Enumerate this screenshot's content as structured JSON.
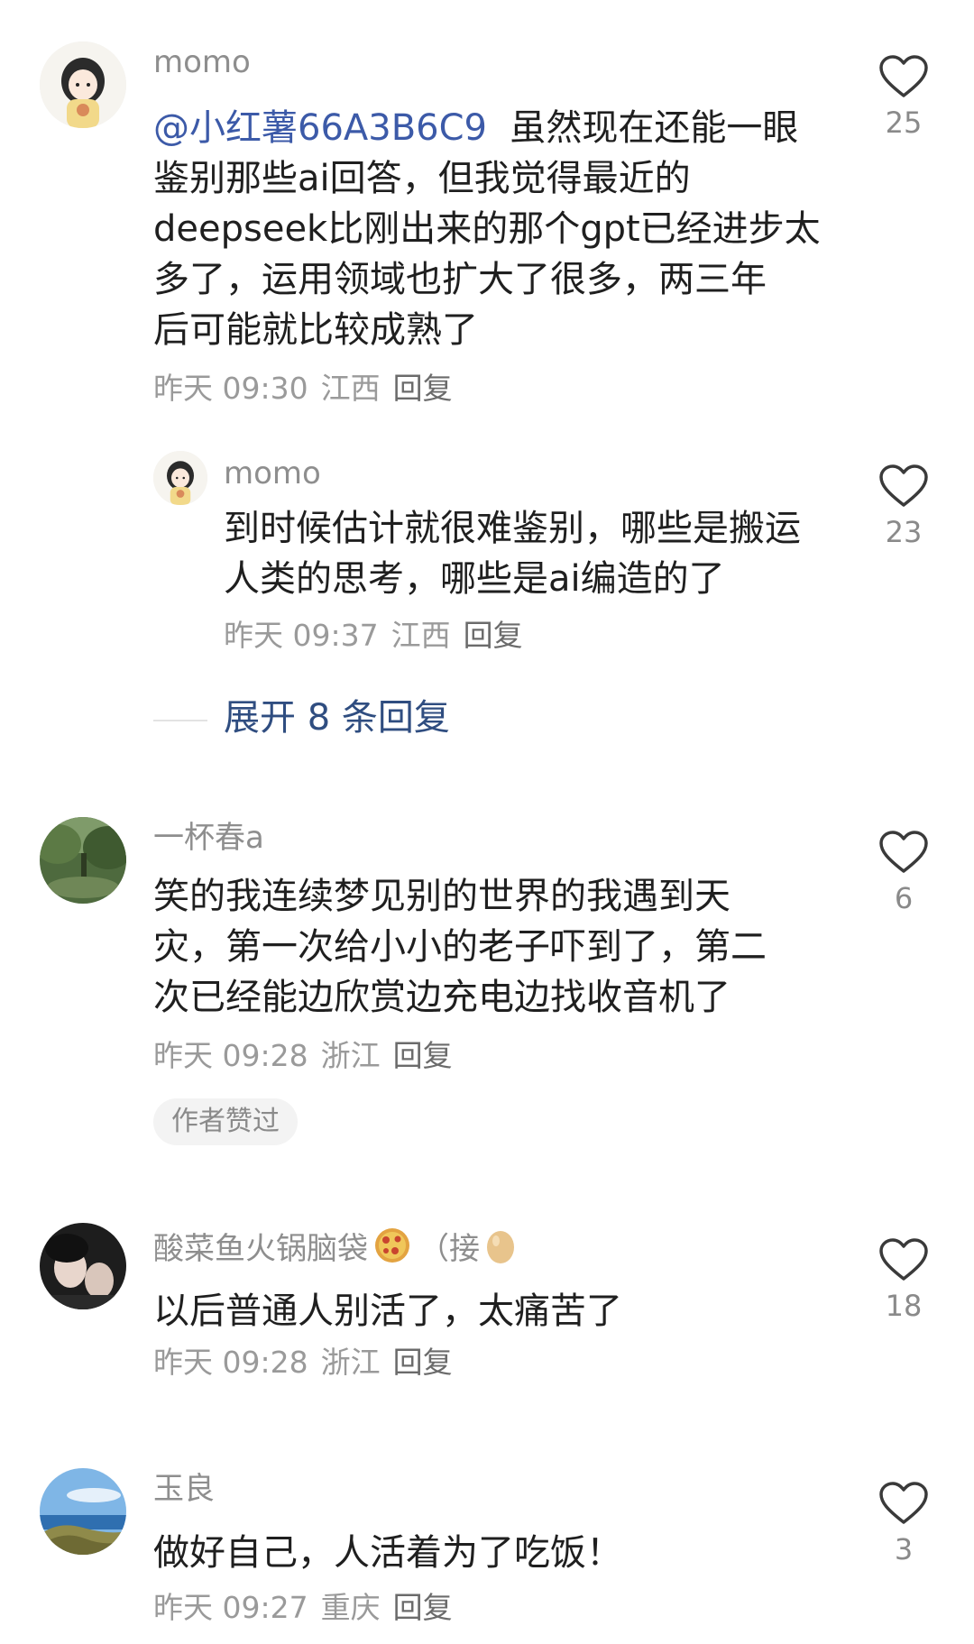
{
  "comments": [
    {
      "username": "momo",
      "mention": "@小红薯66A3B6C9",
      "lines": [
        "虽然现在还能一眼",
        "鉴别那些ai回答，但我觉得最近的",
        "deepseek比刚出来的那个gpt已经进步太",
        "多了，运用领域也扩大了很多，两三年",
        "后可能就比较成熟了"
      ],
      "time": "昨天 09:30",
      "location": "江西",
      "reply_label": "回复",
      "likes": "25"
    },
    {
      "username": "momo",
      "lines": [
        "到时候估计就很难鉴别，哪些是搬运",
        "人类的思考，哪些是ai编造的了"
      ],
      "time": "昨天 09:37",
      "location": "江西",
      "reply_label": "回复",
      "likes": "23"
    },
    {
      "username": "一杯春a",
      "lines": [
        "笑的我连续梦见别的世界的我遇到天",
        "灾，第一次给小小的老子吓到了，第二",
        "次已经能边欣赏边充电边找收音机了"
      ],
      "time": "昨天 09:28",
      "location": "浙江",
      "reply_label": "回复",
      "likes": "6",
      "badge": "作者赞过"
    },
    {
      "username": "酸菜鱼火锅脑袋",
      "username_suffix": "（接",
      "lines": [
        "以后普通人别活了，太痛苦了"
      ],
      "time": "昨天 09:28",
      "location": "浙江",
      "reply_label": "回复",
      "likes": "18"
    },
    {
      "username": "玉良",
      "lines": [
        "做好自己，人活着为了吃饭！"
      ],
      "time": "昨天 09:27",
      "location": "重庆",
      "reply_label": "回复",
      "likes": "3"
    }
  ],
  "expand_replies": "展开 8 条回复",
  "icons": {
    "like": "heart-outline-icon",
    "pizza": "pizza-emoji-icon",
    "egg": "egg-emoji-icon"
  },
  "colors": {
    "mention": "#3c5aa8",
    "expand": "#2f4d80",
    "meta": "#9a9a9a"
  }
}
